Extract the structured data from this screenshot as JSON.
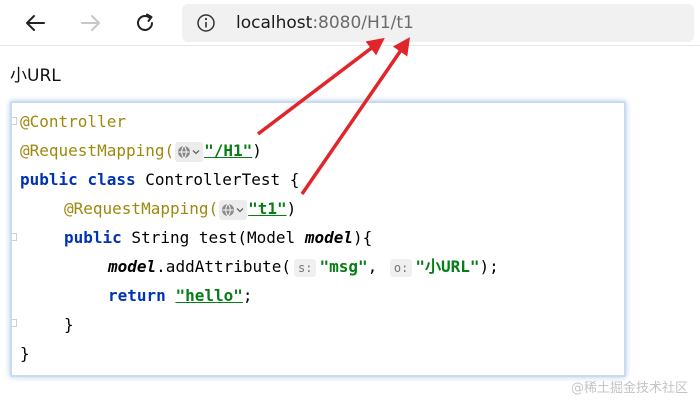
{
  "browser": {
    "url_host": "localhost",
    "url_rest": ":8080/H1/t1",
    "icons": [
      "back-arrow-icon",
      "forward-arrow-icon",
      "refresh-icon",
      "info-icon"
    ]
  },
  "page": {
    "text": "小URL"
  },
  "code": {
    "line1_annotation": "@Controller",
    "line2_annotation": "@RequestMapping(",
    "line2_string": "\"/H1\"",
    "line2_close": ")",
    "line3_kw1": "public",
    "line3_kw2": "class",
    "line3_rest": " ControllerTest {",
    "line4_annotation": "@RequestMapping(",
    "line4_string": "\"t1\"",
    "line4_close": ")",
    "line5_kw": "public",
    "line5_rest": " String test(Model ",
    "line5_param": "model",
    "line5_end": "){",
    "line6_var": "model",
    "line6_method": ".addAttribute(",
    "line6_hint1": "s:",
    "line6_str1": "\"msg\"",
    "line6_comma": ", ",
    "line6_hint2": "o:",
    "line6_str2": "\"小URL\"",
    "line6_end": ");",
    "line7_kw": "return",
    "line7_str": "\"hello\"",
    "line7_end": ";",
    "line8": "}",
    "line9": "}"
  },
  "watermark": "@稀土掘金技术社区",
  "colors": {
    "annotation": "#9e880d",
    "keyword": "#0033b3",
    "string": "#067d17",
    "arrow": "#e0262b"
  }
}
